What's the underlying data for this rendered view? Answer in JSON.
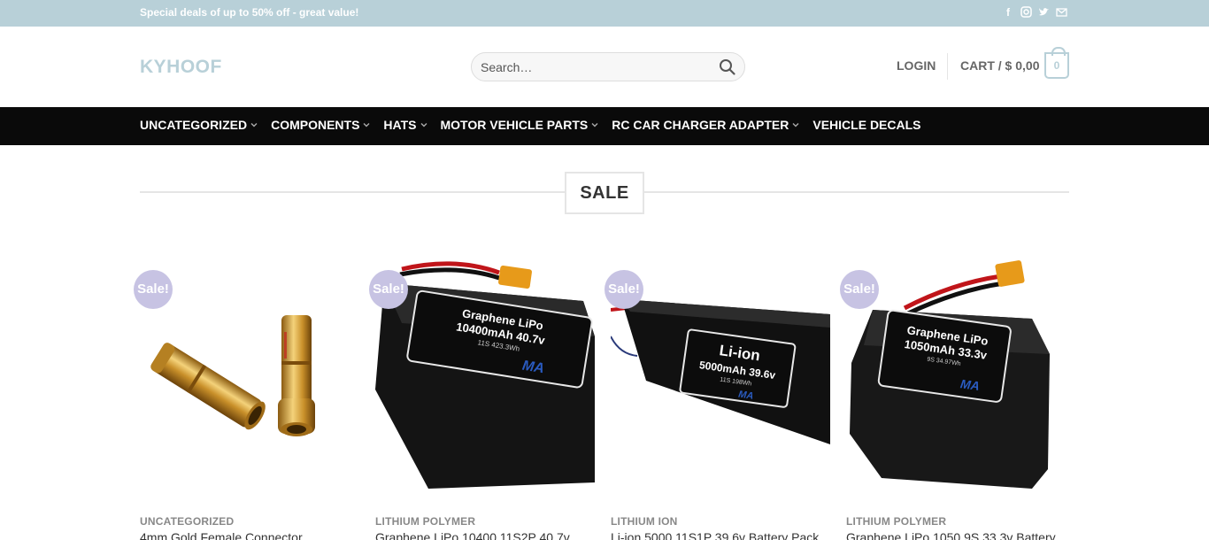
{
  "topbar": {
    "promo": "Special deals of up to 50% off - great value!",
    "social": [
      "facebook-icon",
      "instagram-icon",
      "twitter-icon",
      "email-icon"
    ]
  },
  "header": {
    "logo": "KYHOOF",
    "search_placeholder": "Search…",
    "login": "LOGIN",
    "cart": "CART / $ 0,00",
    "cart_count": "0"
  },
  "nav": {
    "items": [
      {
        "label": "UNCATEGORIZED",
        "dropdown": true
      },
      {
        "label": "COMPONENTS",
        "dropdown": true
      },
      {
        "label": "HATS",
        "dropdown": true
      },
      {
        "label": "MOTOR VEHICLE PARTS",
        "dropdown": true
      },
      {
        "label": "RC CAR CHARGER ADAPTER",
        "dropdown": true
      },
      {
        "label": "VEHICLE DECALS",
        "dropdown": false
      }
    ]
  },
  "section": {
    "title": "SALE"
  },
  "products": [
    {
      "badge": "Sale!",
      "category": "UNCATEGORIZED",
      "name": "4mm Gold Female Connector"
    },
    {
      "badge": "Sale!",
      "category": "LITHIUM POLYMER",
      "name": "Graphene LiPo 10400 11S2P 40.7v",
      "label_line1": "Graphene LiPo",
      "label_line2": "10400mAh 40.7v",
      "label_line3": "11S 423.3Wh"
    },
    {
      "badge": "Sale!",
      "category": "LITHIUM ION",
      "name": "Li-ion 5000 11S1P 39.6v Battery Pack",
      "label_line1": "Li-ion",
      "label_line2": "5000mAh 39.6v",
      "label_line3": "11S 198Wh"
    },
    {
      "badge": "Sale!",
      "category": "LITHIUM POLYMER",
      "name": "Graphene LiPo 1050 9S 33.3v Battery",
      "label_line1": "Graphene LiPo",
      "label_line2": "1050mAh 33.3v",
      "label_line3": "9S 34.97Wh"
    }
  ],
  "colors": {
    "topbar": "#b8d0d8",
    "nav": "#0a0a0a",
    "badge": "#c7c3e3",
    "logo": "#b8d0d8"
  }
}
